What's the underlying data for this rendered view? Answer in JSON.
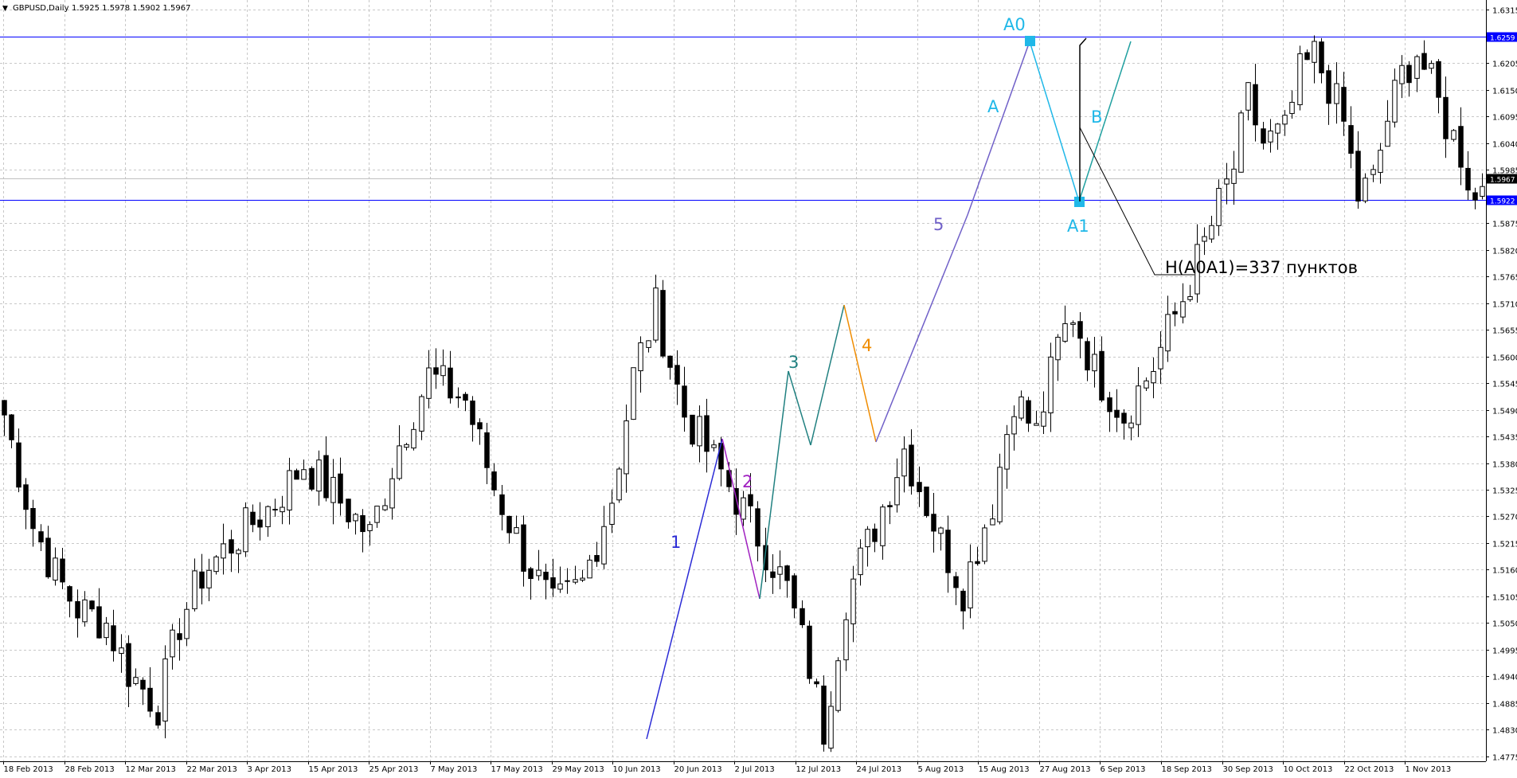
{
  "header": {
    "symbol_label": "GBPUSD,Daily",
    "ohlc_values": "1.5925 1.5978 1.5902 1.5967"
  },
  "colors": {
    "background": "#ffffff",
    "grid": "#c8c8c8",
    "level_line": "#0000ff",
    "bid_line": "#c0c0c0",
    "tag_fill": "#0000ff",
    "candle_up_body": "#ffffff",
    "candle_down_body": "#000000",
    "candle_outline": "#000000",
    "wave_blue": "#2b2bd6",
    "wave_purple": "#a020c0",
    "wave_teal": "#208080",
    "wave_orange": "#f08c00",
    "wave_violet": "#7060c8",
    "pattern_cyan": "#20b8e8",
    "pattern_teal": "#20a0a0",
    "annotation_black": "#000000"
  },
  "chart_data": {
    "type": "candlestick",
    "symbol": "GBPUSD",
    "timeframe": "Daily",
    "grid": true,
    "price_axis": {
      "ticks": [
        "1.6315",
        "1.6205",
        "1.6150",
        "1.6095",
        "1.6040",
        "1.5985",
        "1.5875",
        "1.5820",
        "1.5765",
        "1.5710",
        "1.5655",
        "1.5600",
        "1.5545",
        "1.5490",
        "1.5435",
        "1.5380",
        "1.5325",
        "1.5270",
        "1.5215",
        "1.5160",
        "1.5105",
        "1.5050",
        "1.4995",
        "1.4940",
        "1.4885",
        "1.4830",
        "1.4775"
      ],
      "ylim": [
        1.4765,
        1.6335
      ]
    },
    "time_axis": {
      "labels": [
        "18 Feb 2013",
        "28 Feb 2013",
        "12 Mar 2013",
        "22 Mar 2013",
        "3 Apr 2013",
        "15 Apr 2013",
        "25 Apr 2013",
        "7 May 2013",
        "17 May 2013",
        "29 May 2013",
        "10 Jun 2013",
        "20 Jun 2013",
        "2 Jul 2013",
        "12 Jul 2013",
        "24 Jul 2013",
        "5 Aug 2013",
        "15 Aug 2013",
        "27 Aug 2013",
        "6 Sep 2013",
        "18 Sep 2013",
        "30 Sep 2013",
        "10 Oct 2013",
        "22 Oct 2013",
        "1 Nov 2013"
      ]
    },
    "horizontal_levels": [
      {
        "price": 1.6259,
        "tag": "1.6259",
        "kind": "level"
      },
      {
        "price": 1.5922,
        "tag": "1.5922",
        "kind": "level"
      },
      {
        "price": 1.5967,
        "tag": "1.5967",
        "kind": "bid"
      }
    ],
    "candles_anchor_path": [
      [
        0,
        1.548
      ],
      [
        4,
        1.525
      ],
      [
        7,
        1.515
      ],
      [
        10,
        1.508
      ],
      [
        14,
        1.505
      ],
      [
        17,
        1.495
      ],
      [
        21,
        1.488
      ],
      [
        24,
        1.505
      ],
      [
        27,
        1.515
      ],
      [
        32,
        1.523
      ],
      [
        37,
        1.53
      ],
      [
        41,
        1.538
      ],
      [
        46,
        1.53
      ],
      [
        50,
        1.523
      ],
      [
        54,
        1.542
      ],
      [
        58,
        1.556
      ],
      [
        63,
        1.551
      ],
      [
        67,
        1.533
      ],
      [
        71,
        1.519
      ],
      [
        75,
        1.508
      ],
      [
        79,
        1.513
      ],
      [
        83,
        1.531
      ],
      [
        86,
        1.556
      ],
      [
        89,
        1.57
      ],
      [
        93,
        1.548
      ],
      [
        98,
        1.536
      ],
      [
        103,
        1.523
      ],
      [
        107,
        1.512
      ],
      [
        110,
        1.496
      ],
      [
        112,
        1.483
      ],
      [
        115,
        1.51
      ],
      [
        119,
        1.525
      ],
      [
        123,
        1.541
      ],
      [
        128,
        1.522
      ],
      [
        131,
        1.512
      ],
      [
        135,
        1.53
      ],
      [
        138,
        1.552
      ],
      [
        141,
        1.544
      ],
      [
        144,
        1.562
      ],
      [
        146,
        1.569
      ],
      [
        149,
        1.557
      ],
      [
        153,
        1.548
      ],
      [
        157,
        1.558
      ],
      [
        161,
        1.572
      ],
      [
        165,
        1.587
      ],
      [
        168,
        1.599
      ],
      [
        170,
        1.613
      ],
      [
        172,
        1.604
      ],
      [
        175,
        1.606
      ],
      [
        177,
        1.618
      ],
      [
        179,
        1.622
      ],
      [
        181,
        1.616
      ],
      [
        183,
        1.608
      ],
      [
        185,
        1.593
      ],
      [
        187,
        1.596
      ],
      [
        189,
        1.609
      ],
      [
        191,
        1.618
      ],
      [
        193,
        1.623
      ],
      [
        195,
        1.616
      ],
      [
        197,
        1.608
      ],
      [
        199,
        1.602
      ],
      [
        201,
        1.592
      ],
      [
        202,
        1.5967
      ]
    ],
    "annotations": {
      "wave_labels": [
        "1",
        "2",
        "3",
        "4",
        "5"
      ],
      "pattern_labels": [
        "A0",
        "A",
        "B",
        "A1"
      ],
      "measurement_text": "H(A0A1)=337 пунктов"
    }
  }
}
